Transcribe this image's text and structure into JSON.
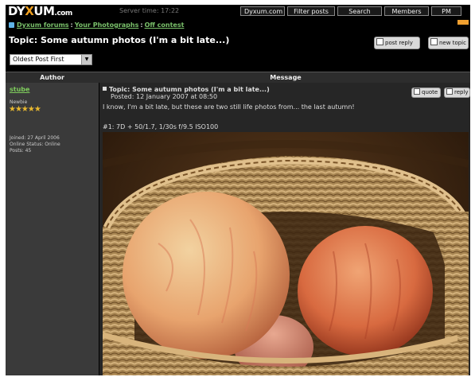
{
  "header": {
    "logo_main": "DY",
    "logo_x": "X",
    "logo_rest": "UM",
    "logo_suffix": ".com",
    "server_time": "Server time: 17:22",
    "nav": [
      "Dyxum.com",
      "Filter posts",
      "Search",
      "Members",
      "PM"
    ]
  },
  "breadcrumb": {
    "items": [
      "Dyxum forums",
      "Your Photographs",
      "Off contest"
    ],
    "separator": ":"
  },
  "topic": {
    "title": "Topic: Some autumn photos (I'm a bit late...)",
    "post_reply": "post reply",
    "new_topic": "new topic"
  },
  "sort": {
    "selected": "Oldest Post First"
  },
  "table": {
    "author_header": "Author",
    "message_header": "Message"
  },
  "author": {
    "name": "stube",
    "rank": "Newbie",
    "stars": "★★★★★",
    "joined": "Joined: 27 April 2006",
    "status": "Online Status: Online",
    "posts": "Posts: 45"
  },
  "post": {
    "subject": "Topic: Some autumn photos (I'm a bit late...)",
    "posted": "Posted: 12 January 2007 at 08:50",
    "quote": "quote",
    "reply": "reply",
    "body": "I know, I'm a bit late, but these are two still life photos from... the last autumn!",
    "caption": "#1: 7D + 50/1.7, 1/30s f/9.5 ISO100"
  },
  "colors": {
    "background": "#000000",
    "link_green": "#7ecb5c",
    "link_blue": "#5fb4e8",
    "accent_orange": "#f0a030",
    "author_panel": "#3a3a3a",
    "message_panel": "#262626"
  }
}
